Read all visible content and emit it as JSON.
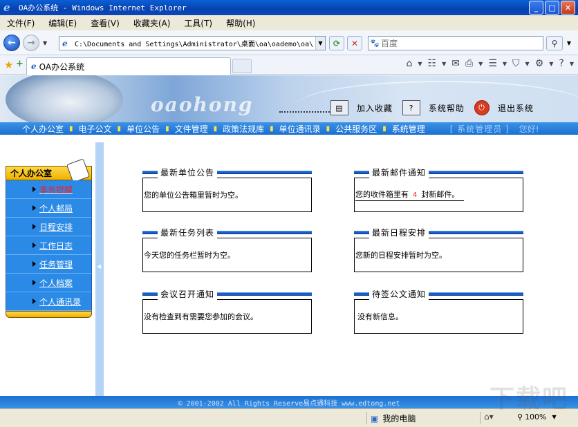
{
  "browser": {
    "window_title": "OA办公系统 - Windows Internet Explorer",
    "menu": [
      "文件(F)",
      "编辑(E)",
      "查看(V)",
      "收藏夹(A)",
      "工具(T)",
      "帮助(H)"
    ],
    "address": "C:\\Documents and Settings\\Administrator\\桌面\\oa\\oademo\\oa\\",
    "search_placeholder": "百度",
    "tab_title": "OA办公系统",
    "status_zone": "我的电脑",
    "zoom": "100%"
  },
  "banner": {
    "logo_text": "oaohong",
    "links": [
      {
        "label": "加入收藏",
        "icon": "folder-icon"
      },
      {
        "label": "系统帮助",
        "icon": "help-icon"
      },
      {
        "label": "退出系统",
        "icon": "power-icon"
      }
    ]
  },
  "nav": {
    "items": [
      "个人办公室",
      "电子公文",
      "单位公告",
      "文件管理",
      "政策法规库",
      "单位通讯录",
      "公共服务区",
      "系统管理"
    ],
    "user": "[ 系统管理员 ]",
    "greeting": "您好!"
  },
  "sidebar": {
    "header": "个人办公室",
    "items": [
      {
        "label": "事务提醒",
        "active": true
      },
      {
        "label": "个人邮局",
        "active": false
      },
      {
        "label": "日程安排",
        "active": false
      },
      {
        "label": "工作日志",
        "active": false
      },
      {
        "label": "任务管理",
        "active": false
      },
      {
        "label": "个人档案",
        "active": false
      },
      {
        "label": "个人通讯录",
        "active": false
      }
    ]
  },
  "panels": {
    "notice": {
      "title": "最新单位公告",
      "body": "您的单位公告箱里暂时为空。"
    },
    "mail": {
      "title": "最新邮件通知",
      "body_prefix": "您的收件箱里有",
      "count": "4",
      "body_suffix": "封新邮件。"
    },
    "tasks": {
      "title": "最新任务列表",
      "body": "今天您的任务栏暂时为空。"
    },
    "schedule": {
      "title": "最新日程安排",
      "body": "您新的日程安排暂时为空。"
    },
    "meeting": {
      "title": "会议召开通知",
      "body": "没有检查到有需要您参加的会议。"
    },
    "approval": {
      "title": "待签公文通知",
      "body": "没有新信息。"
    }
  },
  "footer": {
    "copyright": "© 2001-2002 All Rights Reserve易点通科技 www.edtong.net"
  },
  "watermark": "下载吧"
}
